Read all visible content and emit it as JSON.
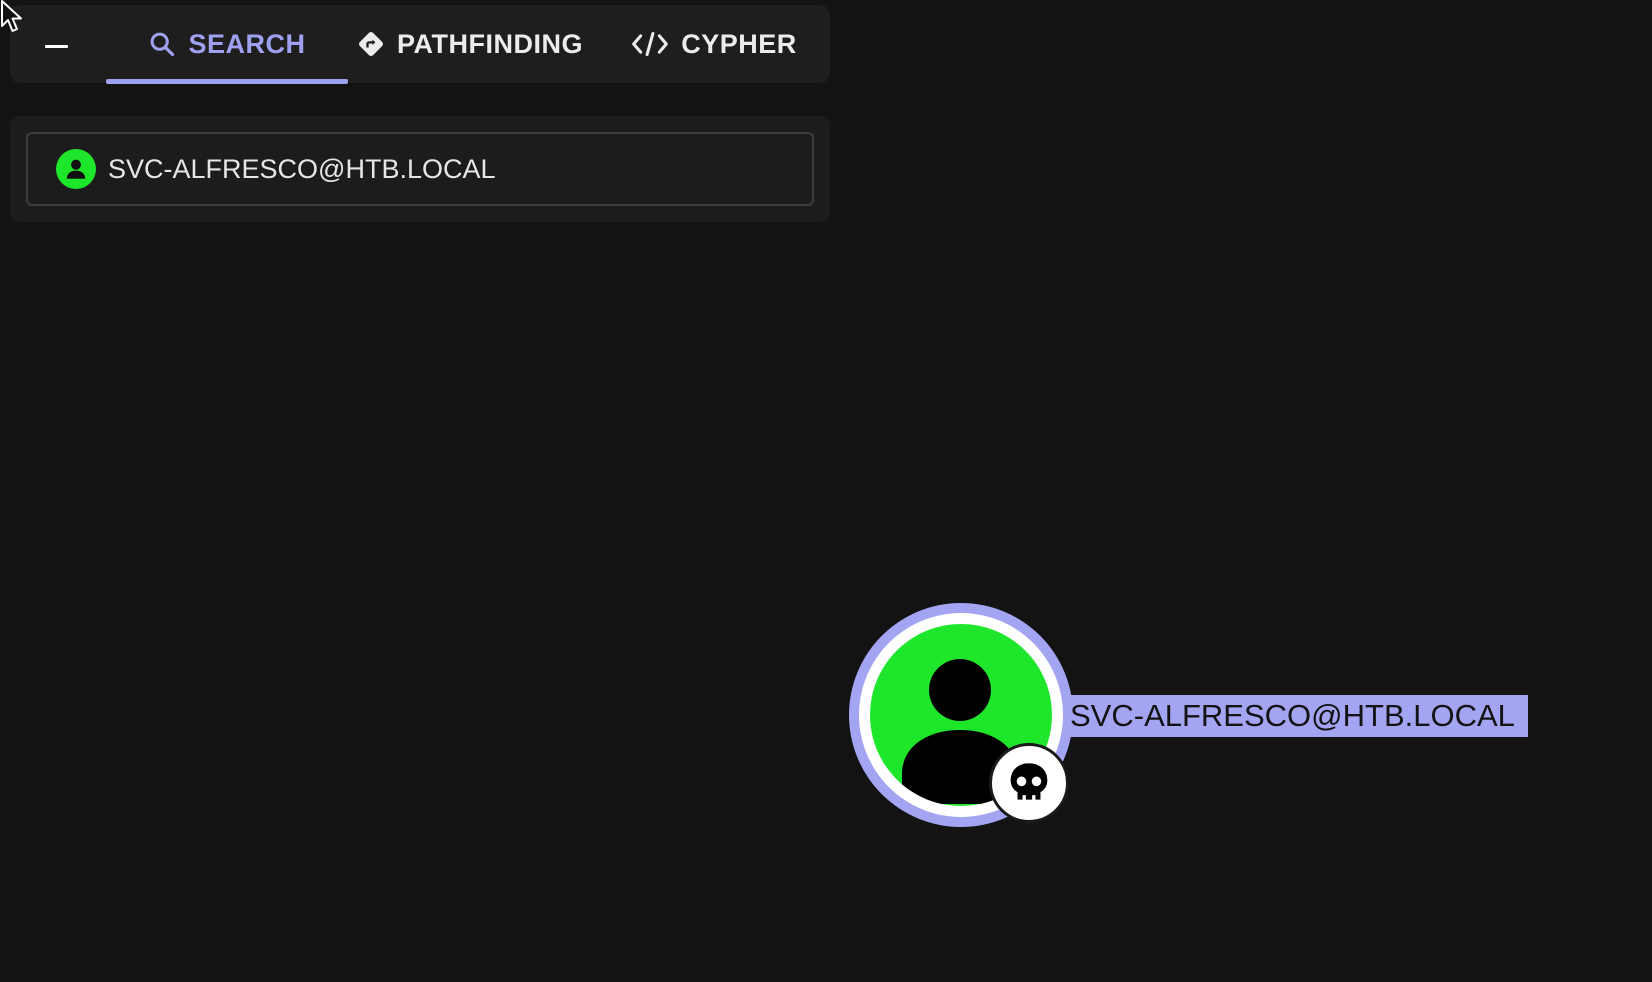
{
  "tabs": [
    {
      "label": "SEARCH",
      "icon": "search-icon",
      "active": true
    },
    {
      "label": "PATHFINDING",
      "icon": "diamond-route-icon",
      "active": false
    },
    {
      "label": "CYPHER",
      "icon": "code-icon",
      "active": false
    }
  ],
  "search": {
    "value": "SVC-ALFRESCO@HTB.LOCAL",
    "icon": "user-icon"
  },
  "graph": {
    "node": {
      "label": "SVC-ALFRESCO@HTB.LOCAL",
      "type_icon": "user-icon",
      "badge_icon": "skull-icon"
    }
  },
  "colors": {
    "background": "#131313",
    "panel": "#1e1e1e",
    "accent": "#9ea0f0",
    "node_selected": "#a3a4f2",
    "user_green": "#1ee62a"
  }
}
